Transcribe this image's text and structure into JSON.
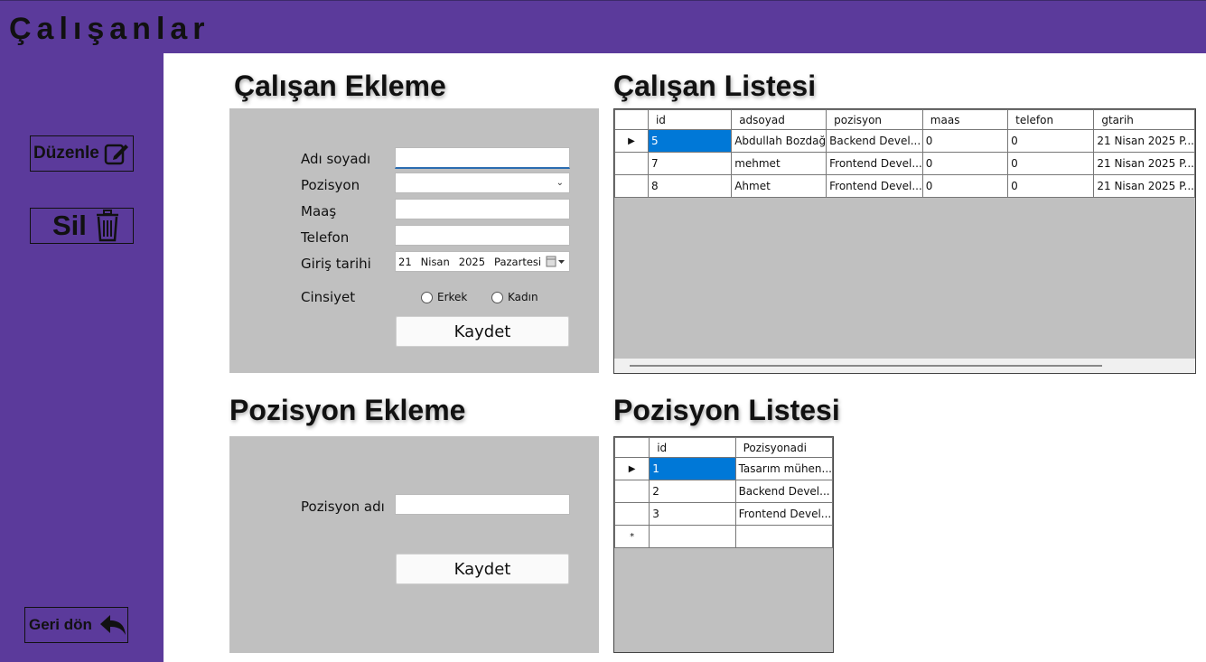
{
  "window": {
    "title": "Çalışanlar"
  },
  "sidebar": {
    "edit_label": "Düzenle",
    "delete_label": "Sil",
    "back_label": "Geri dön"
  },
  "employee_form": {
    "title": "Çalışan Ekleme",
    "name_label": "Adı soyadı",
    "name_value": "",
    "position_label": "Pozisyon",
    "position_value": "",
    "salary_label": "Maaş",
    "salary_value": "",
    "phone_label": "Telefon",
    "phone_value": "",
    "start_date_label": "Giriş tarihi",
    "date": {
      "day": "21",
      "month": "Nisan",
      "year": "2025",
      "weekday": "Pazartesi"
    },
    "gender_label": "Cinsiyet",
    "gender_options": [
      "Erkek",
      "Kadın"
    ],
    "save_label": "Kaydet"
  },
  "employee_list": {
    "title": "Çalışan Listesi",
    "columns": [
      "id",
      "adsoyad",
      "pozisyon",
      "maas",
      "telefon",
      "gtarih"
    ],
    "rows": [
      [
        "5",
        "Abdullah Bozdağ",
        "Backend Devel...",
        "0",
        "0",
        "21 Nisan 2025 P..."
      ],
      [
        "7",
        "mehmet",
        "Frontend Devel...",
        "0",
        "0",
        "21 Nisan 2025 P..."
      ],
      [
        "8",
        "Ahmet",
        "Frontend Devel...",
        "0",
        "0",
        "21 Nisan 2025 P..."
      ]
    ]
  },
  "position_form": {
    "title": "Pozisyon Ekleme",
    "name_label": "Pozisyon adı",
    "name_value": "",
    "save_label": "Kaydet"
  },
  "position_list": {
    "title": "Pozisyon Listesi",
    "columns": [
      "id",
      "Pozisyonadi"
    ],
    "rows": [
      [
        "1",
        "Tasarım mühen..."
      ],
      [
        "2",
        "Backend Devel..."
      ],
      [
        "3",
        "Frontend Devel..."
      ]
    ],
    "new_row_marker": "*"
  },
  "colors": {
    "sidebar": "#5b3a9b",
    "panel": "#c0c0c0",
    "selection": "#0078d7"
  }
}
